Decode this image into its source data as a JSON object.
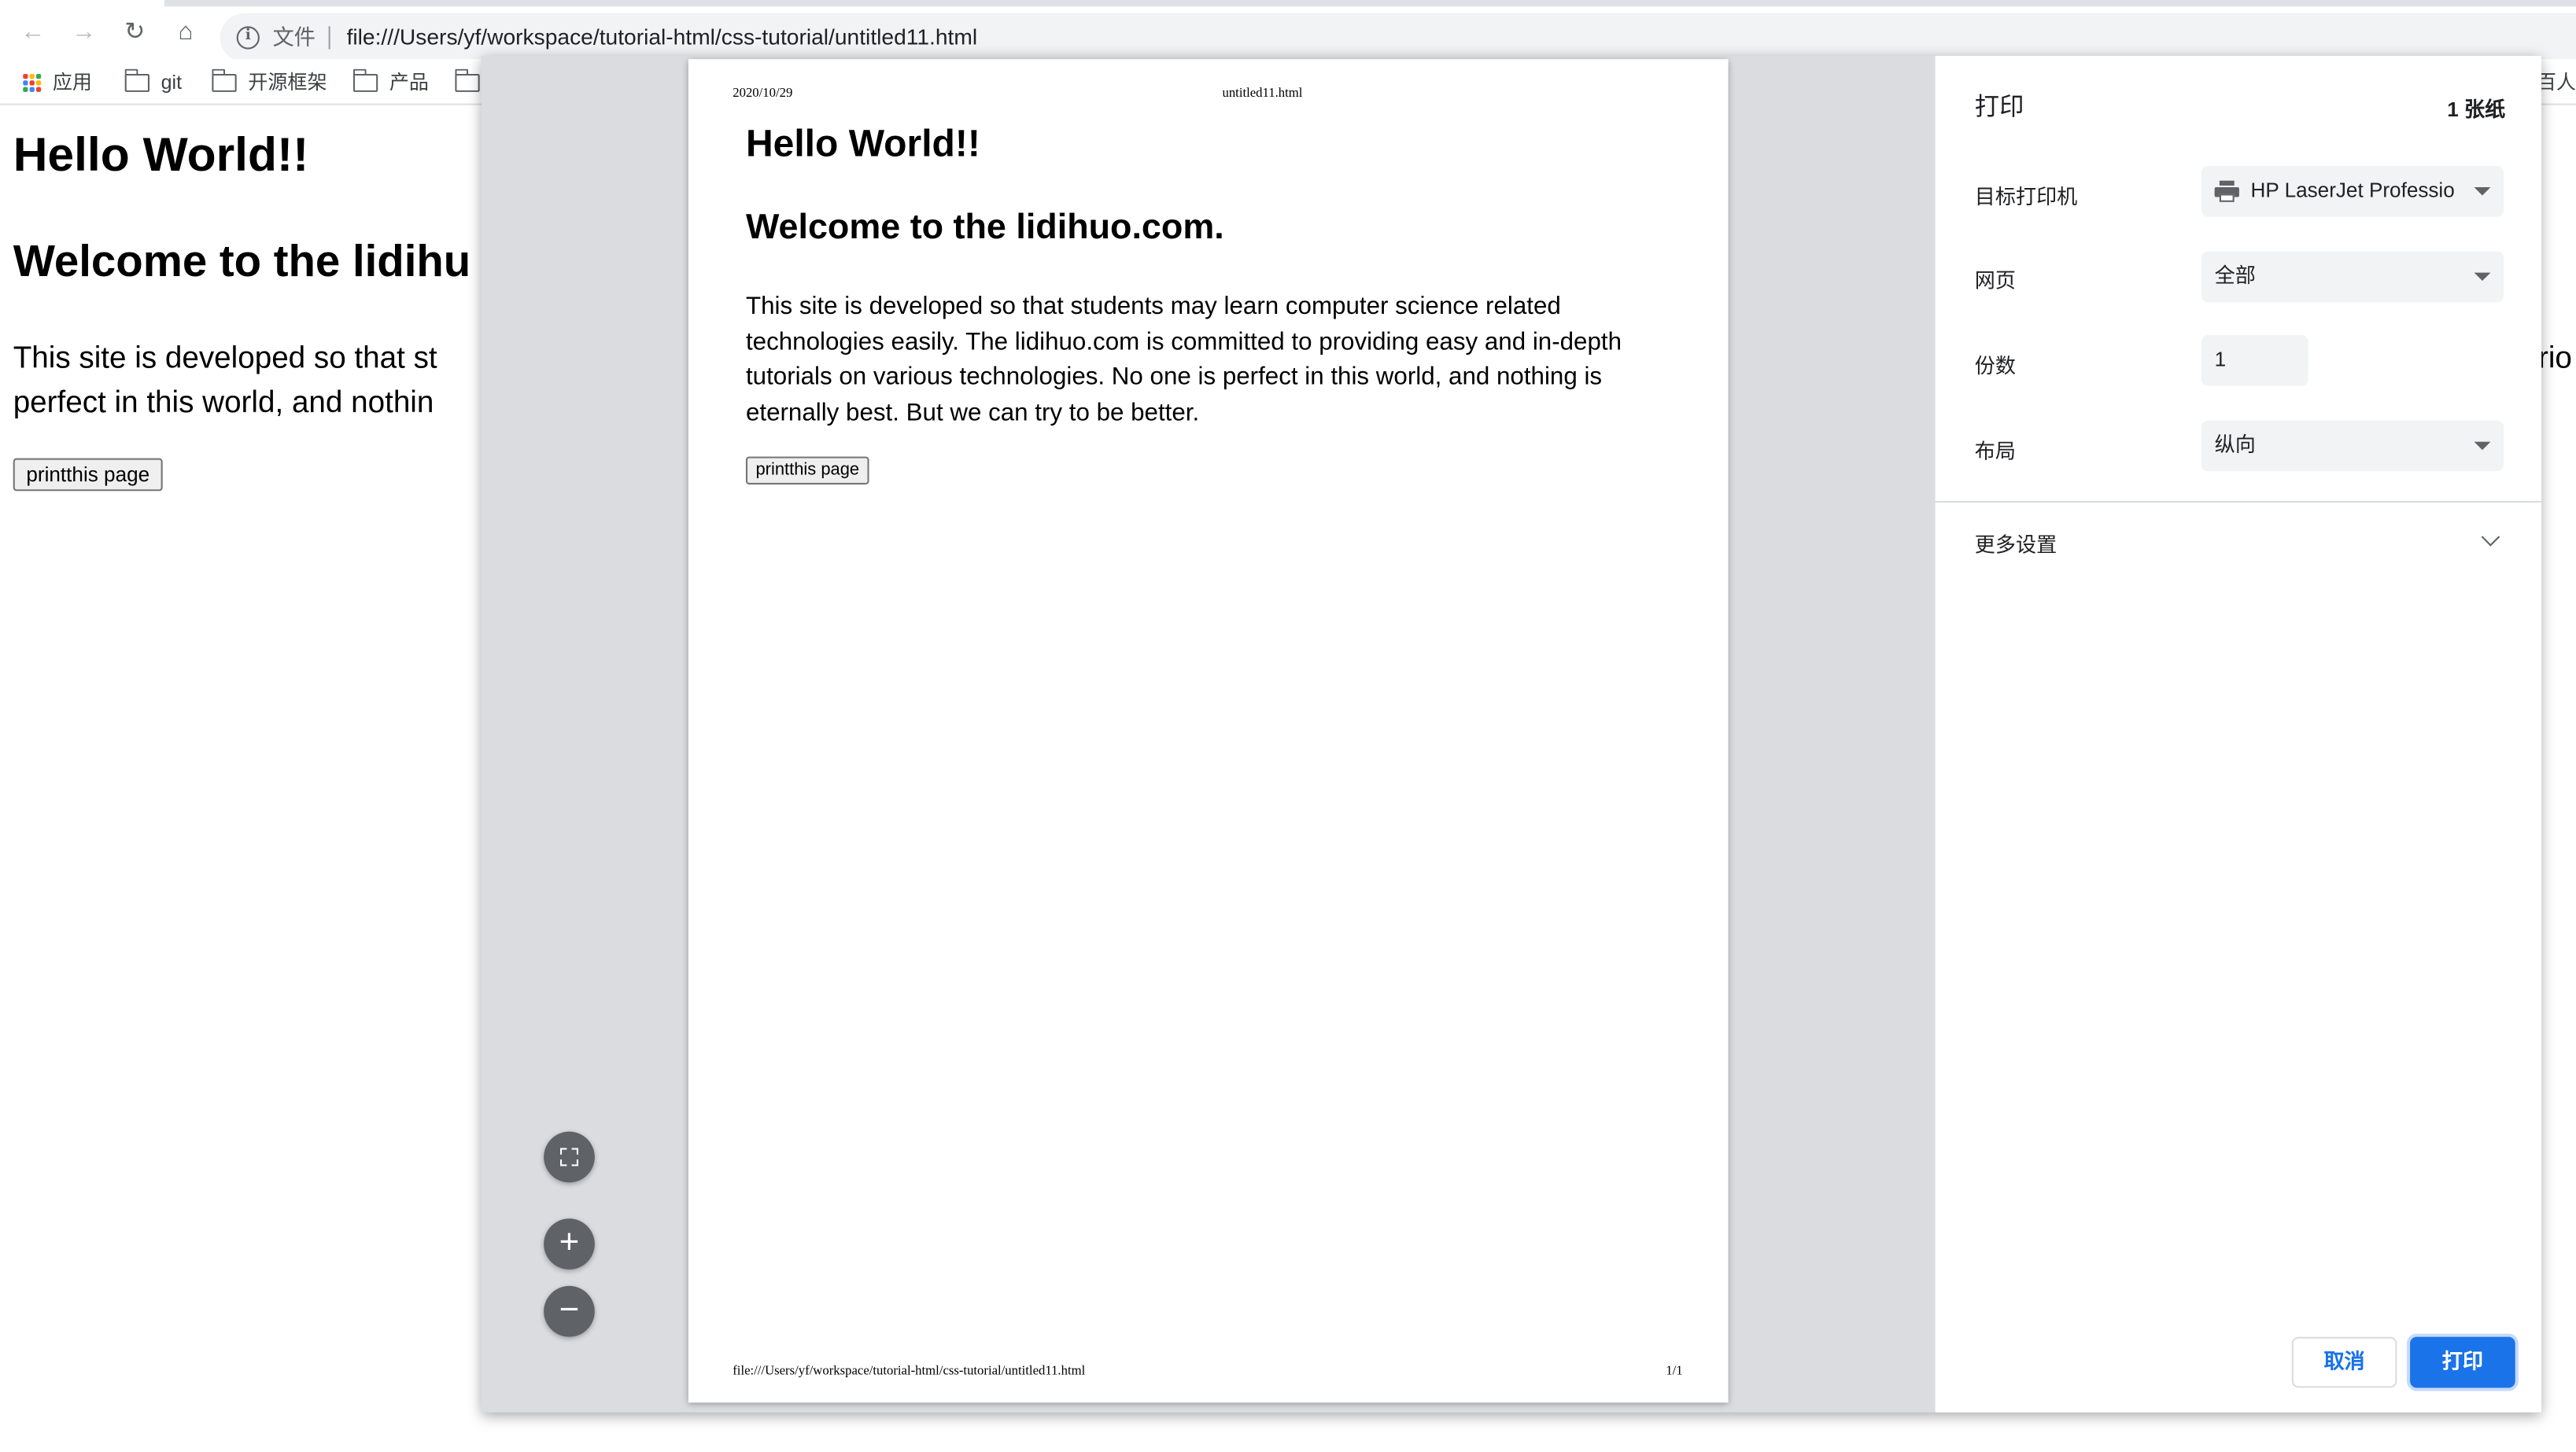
{
  "browser": {
    "nav": {
      "back_icon": "back-arrow-icon",
      "forward_icon": "forward-arrow-icon",
      "reload_icon": "reload-icon",
      "home_icon": "home-icon"
    },
    "omnibox": {
      "security_chip": "文件",
      "url": "file:///Users/yf/workspace/tutorial-html/css-tutorial/untitled11.html"
    },
    "bookmarks": [
      {
        "label": "应用",
        "icon": "apps-grid-icon"
      },
      {
        "label": "git",
        "icon": "folder-icon"
      },
      {
        "label": "开源框架",
        "icon": "folder-icon"
      },
      {
        "label": "产品",
        "icon": "folder-icon"
      }
    ],
    "bookmarks_right_fragment": "-百人"
  },
  "page": {
    "h1": "Hello World!!",
    "h2": "Welcome to the lidihu",
    "paragraph": "This site is developed so that st perfect in this world, and nothin",
    "paragraph_right_fragment": "rio",
    "button": "printthis page"
  },
  "preview": {
    "header_date": "2020/10/29",
    "header_title": "untitled11.html",
    "footer_url": "file:///Users/yf/workspace/tutorial-html/css-tutorial/untitled11.html",
    "footer_page": "1/1",
    "h1": "Hello World!!",
    "h2": "Welcome to the lidihuo.com.",
    "paragraph": "This site is developed so that students may learn computer science related technologies easily. The lidihuo.com is committed to providing easy and in-depth tutorials on various technologies. No one is perfect in this world, and nothing is eternally best. But we can try to be better.",
    "button": "printthis page",
    "zoom": {
      "fit_icon": "fit-to-page-icon",
      "zoom_in_icon": "zoom-in-icon",
      "zoom_out_icon": "zoom-out-icon",
      "zoom_in_glyph": "+",
      "zoom_out_glyph": "−"
    }
  },
  "print_panel": {
    "title": "打印",
    "sheets": "1 张纸",
    "destination_label": "目标打印机",
    "destination_value": "HP LaserJet Professio",
    "pages_label": "网页",
    "pages_value": "全部",
    "copies_label": "份数",
    "copies_value": "1",
    "layout_label": "布局",
    "layout_value": "纵向",
    "more_settings": "更多设置",
    "cancel": "取消",
    "print": "打印",
    "accent_color": "#1a73e8"
  }
}
